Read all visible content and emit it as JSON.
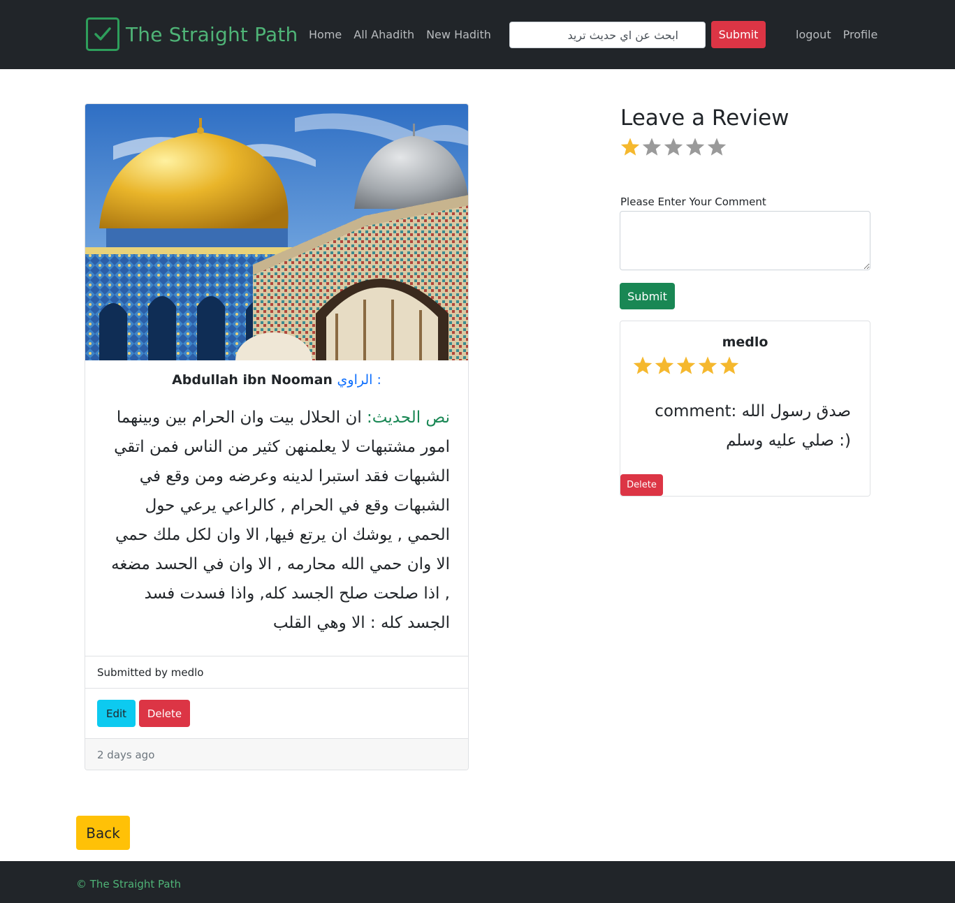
{
  "navbar": {
    "brand": "The Straight Path",
    "links": [
      "Home",
      "All Ahadith",
      "New Hadith"
    ],
    "search_placeholder": "ابحث عن اي حديث تريد",
    "search_button": "Submit",
    "right_links": [
      "logout",
      "Profile"
    ]
  },
  "hadith": {
    "narrator_label": "الراوي :",
    "narrator": "Abdullah ibn Nooman",
    "text_label": "نص الحديث:",
    "text": " ان الحلال بيت وان الحرام بين وبينهما امور مشتبهات لا يعلمنهن كثير من الناس فمن اتقي الشبهات فقد استبرا لدينه وعرضه ومن وقع في الشبهات وقع في الحرام , كالراعي يرعي حول الحمي , يوشك ان يرتع فيها, الا وان لكل ملك حمي الا وان حمي الله محارمه , الا وان في الحسد مضغه , اذا صلحت صلح الجسد كله, واذا فسدت فسد الجسد كله : الا وهي القلب",
    "submitted_by": "Submitted by medlo",
    "edit_button": "Edit",
    "delete_button": "Delete",
    "posted_ago": "2 days ago"
  },
  "review": {
    "title": "Leave a Review",
    "rating": 1,
    "max_rating": 5,
    "comment_label": "Please Enter Your Comment",
    "submit_button": "Submit"
  },
  "reviews": [
    {
      "user": "medlo",
      "rating": 5,
      "comment": "comment: صدق رسول الله صلي عليه وسلم :)",
      "delete_button": "Delete"
    }
  ],
  "back_button": "Back",
  "footer": "© The Straight Path",
  "colors": {
    "navbar_bg": "#212529",
    "brand": "#4fb477",
    "star_filled": "#f5b82e",
    "star_empty": "#9a9a9a",
    "danger": "#dc3545",
    "success": "#198754",
    "info": "#0dcaf0",
    "warning": "#ffc107",
    "link_blue": "#0d6efd"
  }
}
